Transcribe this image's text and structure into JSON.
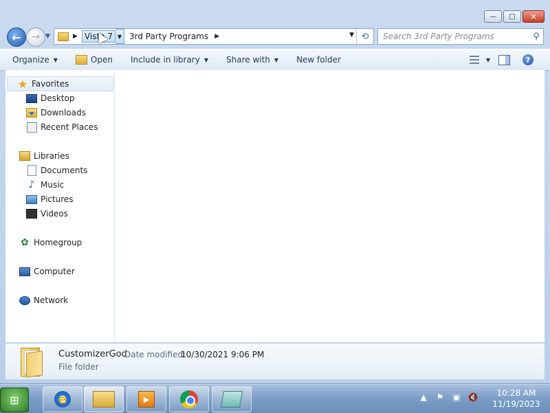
{
  "window": {
    "controls": {
      "minimize": "—",
      "maximize": "□",
      "close": "✕"
    }
  },
  "nav": {
    "back_glyph": "←",
    "forward_glyph": "→",
    "breadcrumbs": [
      "Vista 7",
      "3rd Party Programs"
    ],
    "search_placeholder": "Search 3rd Party Programs"
  },
  "toolbar": {
    "organize": "Organize",
    "open": "Open",
    "include_in_library": "Include in library",
    "share_with": "Share with",
    "new_folder": "New folder",
    "help": "?"
  },
  "sidebar": {
    "favorites": {
      "label": "Favorites",
      "items": [
        "Desktop",
        "Downloads",
        "Recent Places"
      ]
    },
    "libraries": {
      "label": "Libraries",
      "items": [
        "Documents",
        "Music",
        "Pictures",
        "Videos"
      ]
    },
    "homegroup": "Homegroup",
    "computer": "Computer",
    "network": "Network"
  },
  "details": {
    "name": "CustomizerGod",
    "date_modified_label": "Date modified:",
    "date_modified_value": "10/30/2021 9:06 PM",
    "type": "File folder"
  },
  "taskbar": {
    "apps": [
      "internet-explorer",
      "windows-explorer",
      "windows-media-player",
      "google-chrome",
      "notepad-app"
    ],
    "clock_time": "10:28 AM",
    "clock_date": "11/19/2023"
  }
}
